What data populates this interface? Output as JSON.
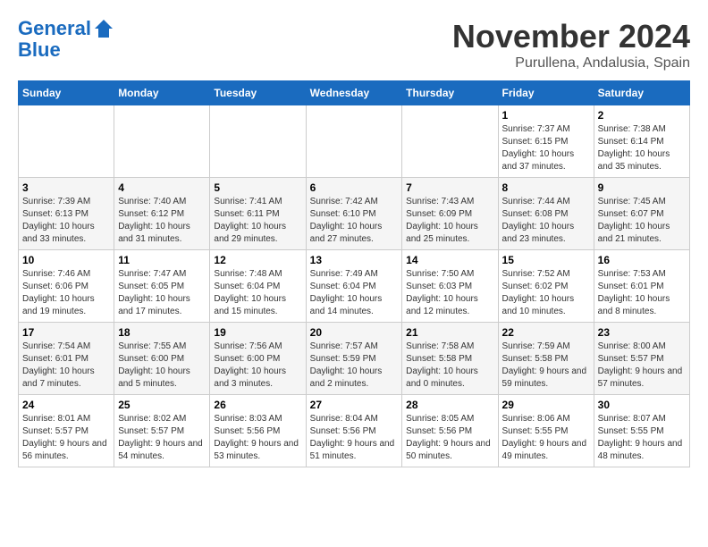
{
  "logo": {
    "line1": "General",
    "line2": "Blue"
  },
  "header": {
    "month": "November 2024",
    "location": "Purullena, Andalusia, Spain"
  },
  "weekdays": [
    "Sunday",
    "Monday",
    "Tuesday",
    "Wednesday",
    "Thursday",
    "Friday",
    "Saturday"
  ],
  "weeks": [
    [
      {
        "day": "",
        "info": ""
      },
      {
        "day": "",
        "info": ""
      },
      {
        "day": "",
        "info": ""
      },
      {
        "day": "",
        "info": ""
      },
      {
        "day": "",
        "info": ""
      },
      {
        "day": "1",
        "info": "Sunrise: 7:37 AM\nSunset: 6:15 PM\nDaylight: 10 hours and 37 minutes."
      },
      {
        "day": "2",
        "info": "Sunrise: 7:38 AM\nSunset: 6:14 PM\nDaylight: 10 hours and 35 minutes."
      }
    ],
    [
      {
        "day": "3",
        "info": "Sunrise: 7:39 AM\nSunset: 6:13 PM\nDaylight: 10 hours and 33 minutes."
      },
      {
        "day": "4",
        "info": "Sunrise: 7:40 AM\nSunset: 6:12 PM\nDaylight: 10 hours and 31 minutes."
      },
      {
        "day": "5",
        "info": "Sunrise: 7:41 AM\nSunset: 6:11 PM\nDaylight: 10 hours and 29 minutes."
      },
      {
        "day": "6",
        "info": "Sunrise: 7:42 AM\nSunset: 6:10 PM\nDaylight: 10 hours and 27 minutes."
      },
      {
        "day": "7",
        "info": "Sunrise: 7:43 AM\nSunset: 6:09 PM\nDaylight: 10 hours and 25 minutes."
      },
      {
        "day": "8",
        "info": "Sunrise: 7:44 AM\nSunset: 6:08 PM\nDaylight: 10 hours and 23 minutes."
      },
      {
        "day": "9",
        "info": "Sunrise: 7:45 AM\nSunset: 6:07 PM\nDaylight: 10 hours and 21 minutes."
      }
    ],
    [
      {
        "day": "10",
        "info": "Sunrise: 7:46 AM\nSunset: 6:06 PM\nDaylight: 10 hours and 19 minutes."
      },
      {
        "day": "11",
        "info": "Sunrise: 7:47 AM\nSunset: 6:05 PM\nDaylight: 10 hours and 17 minutes."
      },
      {
        "day": "12",
        "info": "Sunrise: 7:48 AM\nSunset: 6:04 PM\nDaylight: 10 hours and 15 minutes."
      },
      {
        "day": "13",
        "info": "Sunrise: 7:49 AM\nSunset: 6:04 PM\nDaylight: 10 hours and 14 minutes."
      },
      {
        "day": "14",
        "info": "Sunrise: 7:50 AM\nSunset: 6:03 PM\nDaylight: 10 hours and 12 minutes."
      },
      {
        "day": "15",
        "info": "Sunrise: 7:52 AM\nSunset: 6:02 PM\nDaylight: 10 hours and 10 minutes."
      },
      {
        "day": "16",
        "info": "Sunrise: 7:53 AM\nSunset: 6:01 PM\nDaylight: 10 hours and 8 minutes."
      }
    ],
    [
      {
        "day": "17",
        "info": "Sunrise: 7:54 AM\nSunset: 6:01 PM\nDaylight: 10 hours and 7 minutes."
      },
      {
        "day": "18",
        "info": "Sunrise: 7:55 AM\nSunset: 6:00 PM\nDaylight: 10 hours and 5 minutes."
      },
      {
        "day": "19",
        "info": "Sunrise: 7:56 AM\nSunset: 6:00 PM\nDaylight: 10 hours and 3 minutes."
      },
      {
        "day": "20",
        "info": "Sunrise: 7:57 AM\nSunset: 5:59 PM\nDaylight: 10 hours and 2 minutes."
      },
      {
        "day": "21",
        "info": "Sunrise: 7:58 AM\nSunset: 5:58 PM\nDaylight: 10 hours and 0 minutes."
      },
      {
        "day": "22",
        "info": "Sunrise: 7:59 AM\nSunset: 5:58 PM\nDaylight: 9 hours and 59 minutes."
      },
      {
        "day": "23",
        "info": "Sunrise: 8:00 AM\nSunset: 5:57 PM\nDaylight: 9 hours and 57 minutes."
      }
    ],
    [
      {
        "day": "24",
        "info": "Sunrise: 8:01 AM\nSunset: 5:57 PM\nDaylight: 9 hours and 56 minutes."
      },
      {
        "day": "25",
        "info": "Sunrise: 8:02 AM\nSunset: 5:57 PM\nDaylight: 9 hours and 54 minutes."
      },
      {
        "day": "26",
        "info": "Sunrise: 8:03 AM\nSunset: 5:56 PM\nDaylight: 9 hours and 53 minutes."
      },
      {
        "day": "27",
        "info": "Sunrise: 8:04 AM\nSunset: 5:56 PM\nDaylight: 9 hours and 51 minutes."
      },
      {
        "day": "28",
        "info": "Sunrise: 8:05 AM\nSunset: 5:56 PM\nDaylight: 9 hours and 50 minutes."
      },
      {
        "day": "29",
        "info": "Sunrise: 8:06 AM\nSunset: 5:55 PM\nDaylight: 9 hours and 49 minutes."
      },
      {
        "day": "30",
        "info": "Sunrise: 8:07 AM\nSunset: 5:55 PM\nDaylight: 9 hours and 48 minutes."
      }
    ]
  ]
}
